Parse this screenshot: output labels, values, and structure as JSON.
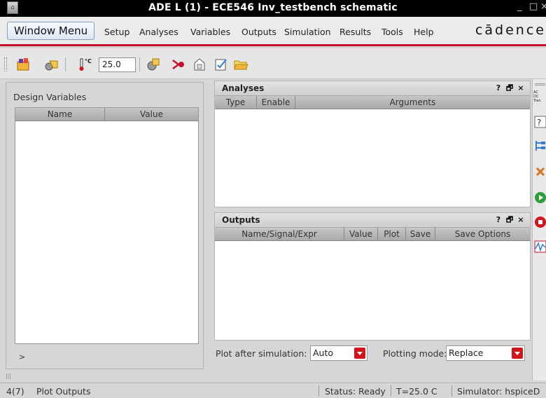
{
  "window": {
    "title": "ADE L (1) - ECE546 Inv_testbench schematic",
    "minimize_glyph": "_",
    "maximize_glyph": "□",
    "close_glyph": "×"
  },
  "menubar": {
    "window_menu": "Window Menu",
    "items": [
      "Setup",
      "Analyses",
      "Variables",
      "Outputs",
      "Simulation",
      "Results",
      "Tools",
      "Help"
    ],
    "brand": "cādence"
  },
  "toolbar": {
    "temperature_value": "25.0",
    "icons": [
      "open-setup-icon",
      "load-state-icon",
      "temperature-icon",
      "edit-variables-icon",
      "choose-analyses-icon",
      "netlist-icon",
      "edit-outputs-icon",
      "open-folder-icon"
    ]
  },
  "design_variables": {
    "title": "Design Variables",
    "columns": [
      "Name",
      "Value"
    ],
    "rows": [],
    "expand_glyph": ">"
  },
  "analyses": {
    "title": "Analyses",
    "columns": [
      "Type",
      "Enable",
      "Arguments"
    ],
    "help_glyph": "?",
    "float_glyph": "🗗",
    "close_glyph": "×"
  },
  "outputs": {
    "title": "Outputs",
    "columns": [
      "Name/Signal/Expr",
      "Value",
      "Plot",
      "Save",
      "Save Options"
    ],
    "help_glyph": "?",
    "float_glyph": "🗗",
    "close_glyph": "×"
  },
  "plotting": {
    "after_sim_label": "Plot after simulation:",
    "after_sim_value": "Auto",
    "mode_label": "Plotting mode:",
    "mode_value": "Replace"
  },
  "right_toolbar": {
    "analysis_types": [
      "AC",
      "DC",
      "Tran"
    ],
    "icons": [
      "analysis-type-icon",
      "parameter-icon",
      "netlist-tree-icon",
      "delete-icon",
      "run-simulation-icon",
      "stop-simulation-icon",
      "plot-waveform-icon"
    ]
  },
  "status": {
    "count": "4(7)",
    "message": "Plot Outputs",
    "state": "Status: Ready",
    "temperature": "T=25.0  C",
    "simulator": "Simulator: hspiceD"
  },
  "colors": {
    "accent_red": "#c8102e",
    "run_green": "#2e9e3a",
    "stop_red": "#d0161c",
    "titlebar_bg": "#000000"
  }
}
